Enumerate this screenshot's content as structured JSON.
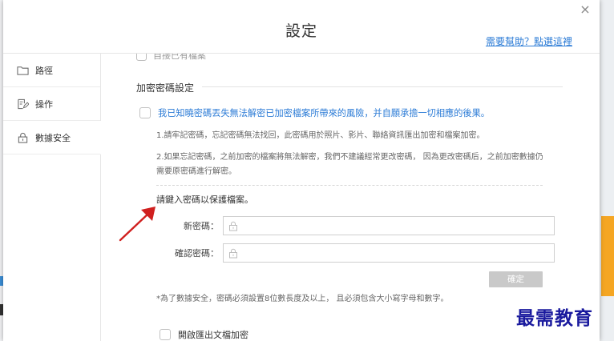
{
  "dialog": {
    "title": "設定",
    "help_link": "需要幫助？點選這裡",
    "close_label": "×"
  },
  "sidebar": {
    "items": [
      {
        "label": "路徑",
        "icon": "folder-icon"
      },
      {
        "label": "操作",
        "icon": "edit-document-icon"
      },
      {
        "label": "數據安全",
        "icon": "lock-icon"
      }
    ],
    "active": "數據安全"
  },
  "content": {
    "cut_option": "自接已有檔案",
    "section_title": "加密密碼設定",
    "warning_checkbox": "我已知曉密碼丟失無法解密已加密檔案所帶來的風險，并自願承擔一切相應的後果。",
    "note1": "1.請牢記密碼，忘記密碼無法找回，此密碼用於照片、影片、聯絡資訊匯出加密和檔案加密。",
    "note2": "2.如果忘記密碼，之前加密的檔案將無法解密，我們不建議經常更改密碼， 因為更改密碼后，之前加密數據仍需要原密碼進行解密。",
    "prompt": "請鍵入密碼以保護檔案。",
    "new_password_label": "新密碼：",
    "confirm_password_label": "確認密碼：",
    "confirm_button": "確定",
    "hint": "*為了數據安全，密碼必須設置8位數長度及以上， 且必須包含大小寫字母和數字。",
    "export_checkbox": "開啟匯出文檔加密"
  },
  "colors": {
    "link_blue": "#2b7bd6",
    "arrow_red": "#d0201f",
    "watermark_blue": "#1a1a9e",
    "button_disabled": "#c9c9c9"
  },
  "watermark": "最需教育"
}
